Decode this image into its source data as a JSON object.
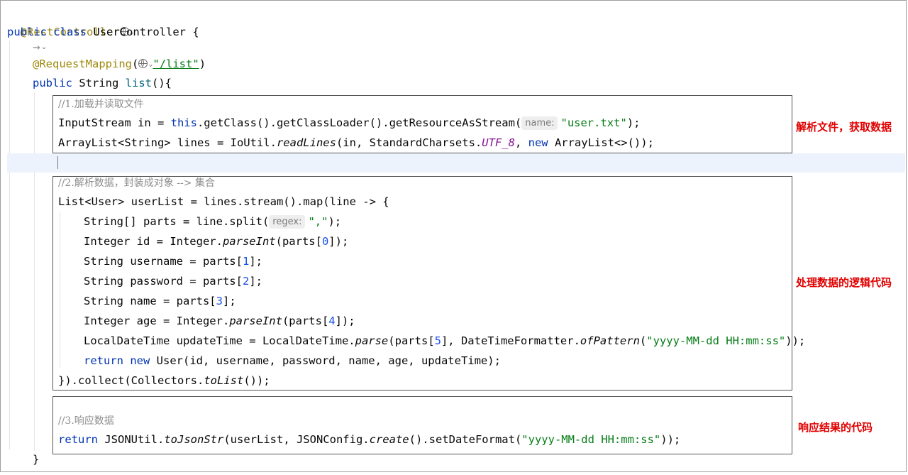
{
  "editor": {
    "annotations": {
      "rest_controller": "@RestController",
      "request_mapping": "@RequestMapping",
      "mapping_path": "\"/list\""
    },
    "class_decl": {
      "public": "public",
      "class": "class",
      "name": "UserController",
      "brace": " {"
    },
    "method_decl": {
      "public": "public",
      "rest": " String ",
      "name": "list",
      "tail": "(){"
    },
    "section1": {
      "comment": "//1.加载并读取文件",
      "line1": {
        "a": "InputStream in = ",
        "this": "this",
        "b": ".getClass().getClassLoader().getResourceAsStream(",
        "hint": "name:",
        "str": "\"user.txt\"",
        "c": ");"
      },
      "line2": {
        "a": "ArrayList<String> lines = IoUtil.",
        "method": "readLines",
        "b": "(in, StandardCharsets.",
        "field": "UTF_8",
        "c": ", ",
        "kw": "new",
        "d": " ArrayList<>());"
      }
    },
    "section2": {
      "comment": "//2.解析数据，封装成对象 --> 集合",
      "l1": "List<User> userList = lines.stream().map(line -> {",
      "l2": {
        "a": "String[] parts = line.split(",
        "hint": "regex:",
        "str": "\",\"",
        "c": ");"
      },
      "l3": {
        "a": "Integer id = Integer.",
        "m": "parseInt",
        "b": "(parts[",
        "n": "0",
        "c": "]);"
      },
      "l4": {
        "a": "String username = parts[",
        "n": "1",
        "c": "];"
      },
      "l5": {
        "a": "String password = parts[",
        "n": "2",
        "c": "];"
      },
      "l6": {
        "a": "String name = parts[",
        "n": "3",
        "c": "];"
      },
      "l7": {
        "a": "Integer age = Integer.",
        "m": "parseInt",
        "b": "(parts[",
        "n": "4",
        "c": "]);"
      },
      "l8": {
        "a": "LocalDateTime updateTime = LocalDateTime.",
        "m": "parse",
        "b": "(parts[",
        "n": "5",
        "c": "], DateTimeFormatter.",
        "m2": "ofPattern",
        "d": "(",
        "str": "\"yyyy-MM-dd HH:mm:ss\"",
        "e": "));"
      },
      "l9": {
        "kw1": "return",
        "sp": " ",
        "kw2": "new",
        "a": " User(id, username, password, name, age, updateTime);"
      },
      "l10": {
        "a": "}).collect(Collectors.",
        "m": "toList",
        "b": "());"
      }
    },
    "section3": {
      "comment": "//3.响应数据",
      "line": {
        "kw": "return",
        "a": " JSONUtil.",
        "m": "toJsonStr",
        "b": "(userList, JSONConfig.",
        "m2": "create",
        "c": "().setDateFormat(",
        "str": "\"yyyy-MM-dd HH:mm:ss\"",
        "d": "));"
      }
    },
    "closing_brace": "}"
  },
  "callouts": {
    "parse_file": "解析文件，获取数据",
    "process_logic": "处理数据的逻辑代码",
    "response_code": "响应结果的代码"
  },
  "colors": {
    "keyword": "#0033b3",
    "annotation": "#9e880d",
    "string": "#067d17",
    "number": "#1750eb",
    "comment": "#8c8c8c",
    "callout": "#e00000"
  },
  "icons": [
    "globe-icon",
    "chevron-down-icon",
    "endpoint-gutter-icon"
  ]
}
